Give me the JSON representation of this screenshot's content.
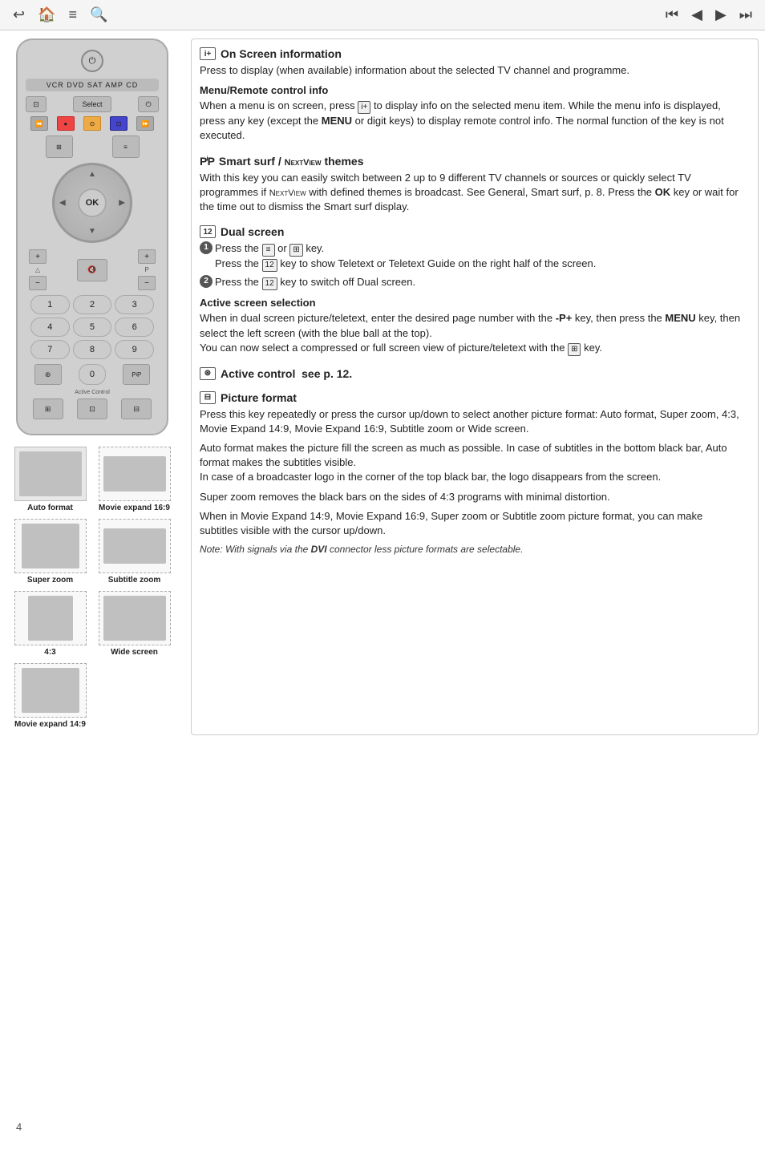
{
  "nav": {
    "left_icons": [
      "back-arrow",
      "home",
      "document",
      "search"
    ],
    "right_icons": [
      "skip-back",
      "prev",
      "next",
      "skip-forward"
    ]
  },
  "remote": {
    "source_row": "VCR DVD SAT AMP CD",
    "ok_label": "OK",
    "numbers": [
      "1",
      "2",
      "3",
      "4",
      "5",
      "6",
      "7",
      "8",
      "9",
      "0"
    ],
    "active_control_label": "Active Control"
  },
  "picture_formats": [
    {
      "id": "auto-format",
      "label": "Auto format",
      "type": "full"
    },
    {
      "id": "movie-expand-16-9",
      "label": "Movie expand 16:9",
      "type": "wide-dashed"
    },
    {
      "id": "super-zoom",
      "label": "Super zoom",
      "type": "super"
    },
    {
      "id": "subtitle-zoom",
      "label": "Subtitle zoom",
      "type": "wide-dashed2"
    },
    {
      "id": "4-3",
      "label": "4:3",
      "type": "normal"
    },
    {
      "id": "wide-screen",
      "label": "Wide screen",
      "type": "wide-dashed3"
    },
    {
      "id": "movie-expand-14-9",
      "label": "Movie expand 14:9",
      "type": "super2"
    }
  ],
  "sections": {
    "on_screen_info": {
      "icon": "i+",
      "title": "On Screen information",
      "body": "Press to display (when available) information about the selected TV channel and programme.",
      "subsections": [
        {
          "title": "Menu/Remote control info",
          "body": "When a menu is on screen, press [i+] to display info on the selected menu item. While the menu info is displayed, press any key (except the MENU or digit keys) to display remote control info. The normal function of the key is not executed."
        }
      ]
    },
    "smart_surf": {
      "icon": "PᴾP",
      "title": "Smart surf / NEXTVIEW themes",
      "body": "With this key you can easily switch between 2 up to 9 different TV channels or sources or quickly select TV programmes if NEXTVIEW with defined themes is broadcast. See General, Smart surf, p. 8. Press the OK key or wait for the time out to dismiss the Smart surf display."
    },
    "dual_screen": {
      "icon": "12",
      "title": "Dual screen",
      "steps": [
        {
          "num": "1",
          "lines": [
            "Press the [≡] or [⊞] key.",
            "Press the [12] key to show Teletext or Teletext Guide on the right half of the screen."
          ]
        },
        {
          "num": "2",
          "lines": [
            "Press the [12] key to switch off Dual screen."
          ]
        }
      ],
      "subsections": [
        {
          "title": "Active screen selection",
          "body": "When in dual screen picture/teletext, enter the desired page number with the -P+ key, then press the MENU key, then select the left screen (with the blue ball at the top).\nYou can now select a compressed or full screen view of picture/teletext with the [⊞] key."
        }
      ]
    },
    "active_control": {
      "icon": "⊛",
      "title": "Active control",
      "suffix": "see p. 12."
    },
    "picture_format": {
      "icon": "⊞",
      "title": "Picture format",
      "paragraphs": [
        "Press this key repeatedly or press the cursor up/down to select another picture format: Auto format, Super zoom, 4:3, Movie Expand 14:9, Movie Expand 16:9, Subtitle zoom or Wide screen.",
        "Auto format makes the picture fill the screen as much as possible. In case of subtitles in the bottom black bar, Auto format makes the subtitles visible.\nIn case of a broadcaster logo in the corner of the top black bar, the logo disappears from the screen.",
        "Super zoom removes the black bars on the sides of 4:3 programs with minimal distortion.",
        "When in Movie Expand 14:9, Movie Expand 16:9, Super zoom or Subtitle zoom picture format, you can make subtitles visible with the cursor up/down.",
        "Note: With signals via the DVI connector less picture formats are selectable."
      ]
    }
  },
  "page_number": "4"
}
